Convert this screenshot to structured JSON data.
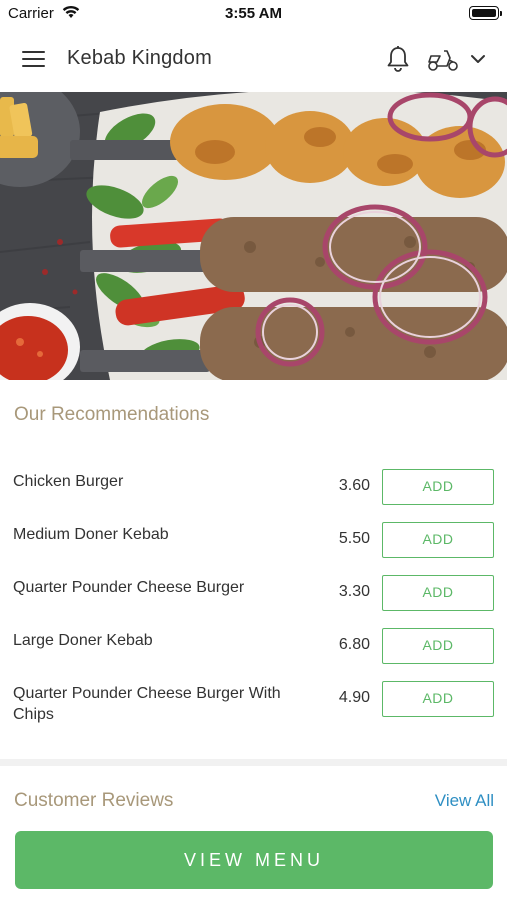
{
  "status_bar": {
    "carrier": "Carrier",
    "time": "3:55 AM"
  },
  "header": {
    "title": "Kebab Kingdom"
  },
  "icons": [
    "menu-icon",
    "bell-icon",
    "delivery-scooter-icon",
    "chevron-down-icon",
    "wifi-icon",
    "battery-icon"
  ],
  "recommendations": {
    "title": "Our Recommendations",
    "add_label": "ADD",
    "items": [
      {
        "name": "Chicken Burger",
        "price": "3.60"
      },
      {
        "name": "Medium Doner Kebab",
        "price": "5.50"
      },
      {
        "name": "Quarter Pounder Cheese Burger",
        "price": "3.30"
      },
      {
        "name": "Large Doner Kebab",
        "price": "6.80"
      },
      {
        "name": "Quarter Pounder Cheese Burger With Chips",
        "price": "4.90"
      }
    ]
  },
  "reviews": {
    "title": "Customer Reviews",
    "view_all": "View All"
  },
  "cta": {
    "label": "VIEW MENU"
  },
  "colors": {
    "accent_green": "#5cb867",
    "section_title": "#a8987a",
    "link_blue": "#2f8fc3"
  }
}
